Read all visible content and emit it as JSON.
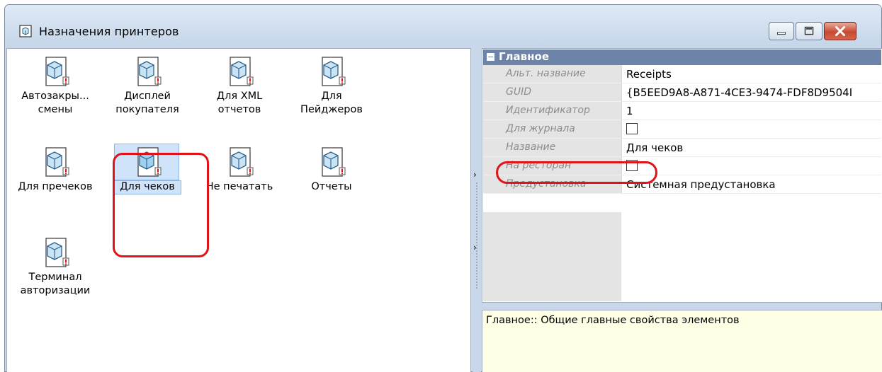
{
  "window": {
    "title": "Назначения принтеров",
    "controls": [
      "minimize-icon",
      "maximize-icon",
      "close-icon"
    ]
  },
  "printers": [
    {
      "label_line1": "Автозакры...",
      "label_line2": "смены"
    },
    {
      "label_line1": "Дисплей",
      "label_line2": "покупателя"
    },
    {
      "label_line1": "Для XML",
      "label_line2": "отчетов"
    },
    {
      "label_line1": "Для",
      "label_line2": "Пейджеров"
    },
    {
      "label_line1": "Для пречеков",
      "label_line2": ""
    },
    {
      "label_line1": "Для чеков",
      "label_line2": "",
      "selected": true
    },
    {
      "label_line1": "Не печатать",
      "label_line2": ""
    },
    {
      "label_line1": "Отчеты",
      "label_line2": ""
    },
    {
      "label_line1": "Терминал",
      "label_line2": "авторизации"
    }
  ],
  "properties": {
    "category": "Главное",
    "rows": [
      {
        "name": "Альт. название",
        "value": "Receipts",
        "type": "text"
      },
      {
        "name": "GUID",
        "value": "{B5EED9A8-A871-4CE3-9474-FDF8D9504I",
        "type": "text"
      },
      {
        "name": "Идентификатор",
        "value": "1",
        "type": "text"
      },
      {
        "name": "Для журнала",
        "value": "",
        "type": "checkbox"
      },
      {
        "name": "Название",
        "value": "Для чеков",
        "type": "text"
      },
      {
        "name": "На ресторан",
        "value": "",
        "type": "checkbox"
      },
      {
        "name": "Предустановка",
        "value": "Системная предустановка",
        "type": "text"
      }
    ]
  },
  "description": "Главное:: Общие главные свойства элементов",
  "colors": {
    "category_header": "#6e83a8",
    "highlight": "#e0121a",
    "description_bg": "#ffffe6"
  }
}
